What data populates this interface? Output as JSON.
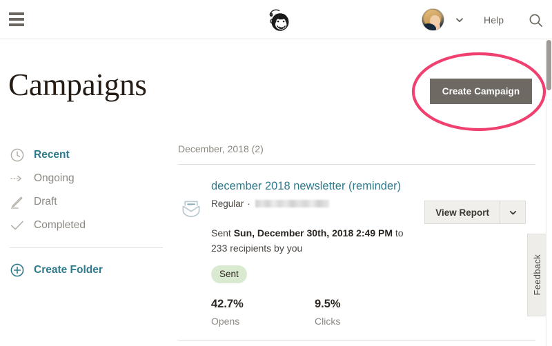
{
  "topbar": {
    "menu_icon": "hamburger-menu-icon",
    "logo_icon": "mailchimp-freddie-logo",
    "avatar_alt": "user-avatar-photo",
    "user_chevron_icon": "chevron-down-icon",
    "help_label": "Help",
    "search_icon": "search-icon"
  },
  "page": {
    "title": "Campaigns"
  },
  "sidebar": {
    "items": [
      {
        "label": "Recent",
        "icon": "clock-icon",
        "active": true
      },
      {
        "label": "Ongoing",
        "icon": "dotted-arrow-icon",
        "active": false
      },
      {
        "label": "Draft",
        "icon": "pencil-icon",
        "active": false
      },
      {
        "label": "Completed",
        "icon": "checkmark-icon",
        "active": false
      }
    ],
    "create_folder": {
      "label": "Create Folder",
      "icon": "plus-circle-icon"
    }
  },
  "actions": {
    "create_campaign_label": "Create Campaign",
    "highlight_color": "#ed २०५6 7f"
  },
  "annotation": {
    "shape": "ellipse",
    "color": "#ef406f",
    "stroke_width": 4,
    "target": "create-campaign-button"
  },
  "main": {
    "month_header": "December, 2018 (2)",
    "campaign": {
      "icon": "open-envelope-icon",
      "title": "december 2018 newsletter (reminder)",
      "type": "Regular",
      "separator": "·",
      "audience": "",
      "view_report_label": "View Report",
      "dropdown_icon": "chevron-down-icon",
      "sent_prefix": "Sent",
      "sent_date": "Sun, December 30th, 2018 2:49 PM",
      "sent_middle": "to",
      "sent_suffix": "233 recipients by you",
      "status": "Sent",
      "status_color": "#d9ead0",
      "stats": [
        {
          "value": "42.7%",
          "label": "Opens"
        },
        {
          "value": "9.5%",
          "label": "Clicks"
        }
      ]
    }
  },
  "feedback": {
    "label": "Feedback"
  },
  "colors": {
    "teal": "#2d7a8c",
    "gray_button": "#6e6963",
    "text_muted": "#8d8881"
  }
}
